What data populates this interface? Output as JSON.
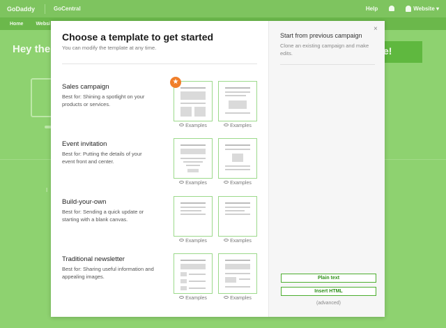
{
  "topbar": {
    "logo": "GoDaddy",
    "brand": "GoCentral",
    "help": "Help",
    "user_menu": "Website ▾"
  },
  "navbar": {
    "home": "Home",
    "website": "Websi"
  },
  "background": {
    "heading": "Hey the",
    "cta": "e!",
    "lower_text": "I"
  },
  "modal": {
    "title": "Choose a template to get started",
    "subtitle": "You can modify the template at any time.",
    "close_icon": "×",
    "templates": [
      {
        "name": "Sales campaign",
        "desc": "Best for: Shining a spotlight on your products or services.",
        "ex1": "Examples",
        "ex2": "Examples",
        "featured": true
      },
      {
        "name": "Event invitation",
        "desc": "Best for: Putting the details of your event front and center.",
        "ex1": "Examples",
        "ex2": "Examples"
      },
      {
        "name": "Build-your-own",
        "desc": "Best for: Sending a quick update or starting with a blank canvas.",
        "ex1": "Examples",
        "ex2": "Examples"
      },
      {
        "name": "Traditional newsletter",
        "desc": "Best for: Sharing useful information and appealing images.",
        "ex1": "Examples",
        "ex2": "Examples"
      }
    ],
    "right": {
      "title": "Start from previous campaign",
      "desc": "Clone an existing campaign and make edits.",
      "plain_text_button": "Plain text",
      "insert_html_button": "Insert HTML",
      "advanced_note": "(advanced)"
    }
  },
  "colors": {
    "accent_green": "#4cae2f",
    "background_green": "#8ed270",
    "featured_orange": "#f07f2a"
  },
  "icons": {
    "featured": "star-icon",
    "preview": "eye-icon",
    "notifications": "bell-icon",
    "user": "user-icon"
  }
}
